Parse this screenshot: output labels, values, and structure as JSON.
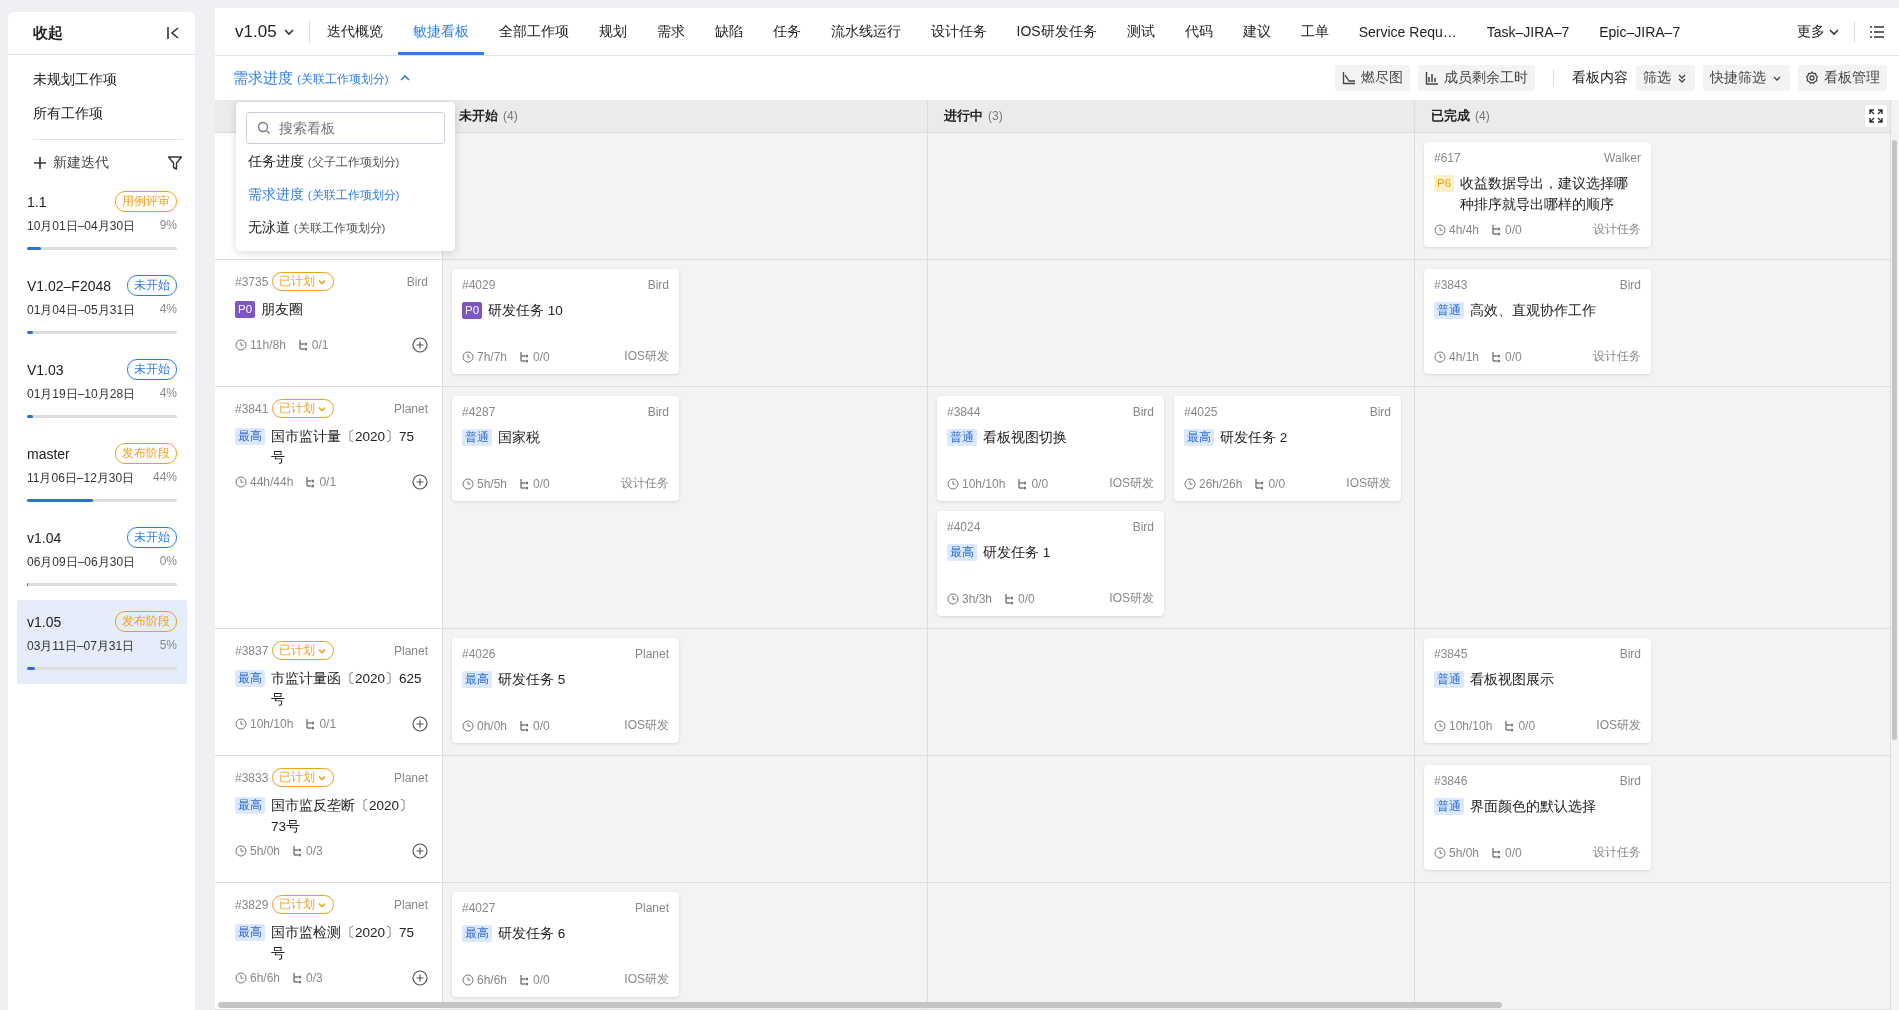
{
  "sidebar": {
    "header": "收起",
    "links": [
      "未规划工作项",
      "所有工作项"
    ],
    "new_label": "新建迭代",
    "iterations": [
      {
        "name": "1.1",
        "badge": "用例评审",
        "color": "#f0a020",
        "dates": "10月01日–04月30日",
        "percent": "9%",
        "level": 0.09,
        "selected": false
      },
      {
        "name": "V1.02–F2048",
        "badge": "未开始",
        "color": "#2f7ee8",
        "dates": "01月04日–05月31日",
        "percent": "4%",
        "level": 0.04,
        "selected": false
      },
      {
        "name": "V1.03",
        "badge": "未开始",
        "color": "#2f7ee8",
        "dates": "01月19日–10月28日",
        "percent": "4%",
        "level": 0.04,
        "selected": false
      },
      {
        "name": "master",
        "badge": "发布阶段",
        "color": "#f0a020",
        "dates": "11月06日–12月30日",
        "percent": "44%",
        "level": 0.44,
        "selected": false
      },
      {
        "name": "v1.04",
        "badge": "未开始",
        "color": "#2f7ee8",
        "dates": "06月09日–06月30日",
        "percent": "0%",
        "level": 0,
        "selected": false
      },
      {
        "name": "v1.05",
        "badge": "发布阶段",
        "color": "#f0a020",
        "dates": "03月11日–07月31日",
        "percent": "5%",
        "level": 0.05,
        "selected": true
      }
    ]
  },
  "version": "v1.05",
  "tabs": [
    {
      "label": "迭代概览",
      "selected": false
    },
    {
      "label": "敏捷看板",
      "selected": true
    },
    {
      "label": "全部工作项",
      "selected": false
    },
    {
      "label": "规划",
      "selected": false
    },
    {
      "label": "需求",
      "selected": false
    },
    {
      "label": "缺陷",
      "selected": false
    },
    {
      "label": "任务",
      "selected": false
    },
    {
      "label": "流水线运行",
      "selected": false
    },
    {
      "label": "设计任务",
      "selected": false
    },
    {
      "label": "IOS研发任务",
      "selected": false
    },
    {
      "label": "测试",
      "selected": false
    },
    {
      "label": "代码",
      "selected": false
    },
    {
      "label": "建议",
      "selected": false
    },
    {
      "label": "工单",
      "selected": false
    },
    {
      "label": "Service Requ…",
      "selected": false
    },
    {
      "label": "Task–JIRA–7",
      "selected": false
    },
    {
      "label": "Epic–JIRA–7",
      "selected": false
    }
  ],
  "more": "更多",
  "board_title": {
    "title": "需求进度",
    "note": "(关联工作项划分)"
  },
  "toolbar": {
    "burndown": "燃尽图",
    "member_hours": "成员剩余工时",
    "content_label": "看板内容",
    "filter": "筛选",
    "quick_filter": "快捷筛选",
    "manage": "看板管理"
  },
  "dropdown": {
    "placeholder": "搜索看板",
    "items": [
      {
        "text": "任务进度",
        "note": "(父子工作项划分)",
        "selected": false
      },
      {
        "text": "需求进度",
        "note": "(关联工作项划分)",
        "selected": true
      },
      {
        "text": "无泳道",
        "note": "(关联工作项划分)",
        "selected": false
      }
    ]
  },
  "columns": [
    {
      "title": "未开始",
      "count": "(4)"
    },
    {
      "title": "进行中",
      "count": "(3)"
    },
    {
      "title": "已完成",
      "count": "(4)"
    }
  ],
  "lanes": [
    {
      "cells": [
        [],
        [],
        [
          {
            "id": "#617",
            "owner": "Walker",
            "priority": {
              "text": "P6",
              "kind": "warn"
            },
            "title": "收益数据导出，建议选择哪种排序就导出哪样的顺序",
            "time": "4h/4h",
            "subtasks": "0/0",
            "type": "设计任务"
          }
        ]
      ]
    },
    {
      "lane": {
        "id": "#3735",
        "status": "已计划",
        "owner": "Bird",
        "priority": {
          "text": "P0",
          "kind": "p0"
        },
        "title": "朋友圈",
        "time": "11h/8h",
        "subtasks": "0/1"
      },
      "cells": [
        [
          {
            "id": "#4029",
            "owner": "Bird",
            "priority": {
              "text": "P0",
              "kind": "p0"
            },
            "title": "研发任务 10",
            "time": "7h/7h",
            "subtasks": "0/0",
            "type": "IOS研发"
          }
        ],
        [],
        [
          {
            "id": "#3843",
            "owner": "Bird",
            "priority": {
              "text": "普通",
              "kind": "info"
            },
            "title": "高效、直观协作工作",
            "time": "4h/1h",
            "subtasks": "0/0",
            "type": "设计任务"
          }
        ]
      ]
    },
    {
      "lane": {
        "id": "#3841",
        "status": "已计划",
        "owner": "Planet",
        "priority": {
          "text": "最高",
          "kind": "info"
        },
        "title": "国市监计量〔2020〕75号",
        "time": "44h/44h",
        "subtasks": "0/1"
      },
      "cells": [
        [
          {
            "id": "#4287",
            "owner": "Bird",
            "priority": {
              "text": "普通",
              "kind": "info"
            },
            "title": "国家税",
            "time": "5h/5h",
            "subtasks": "0/0",
            "type": "设计任务"
          }
        ],
        [
          {
            "id": "#3844",
            "owner": "Bird",
            "priority": {
              "text": "普通",
              "kind": "info"
            },
            "title": "看板视图切换",
            "time": "10h/10h",
            "subtasks": "0/0",
            "type": "IOS研发"
          },
          {
            "id": "#4025",
            "owner": "Bird",
            "priority": {
              "text": "最高",
              "kind": "info"
            },
            "title": "研发任务 2",
            "time": "26h/26h",
            "subtasks": "0/0",
            "type": "IOS研发"
          },
          {
            "id": "#4024",
            "owner": "Bird",
            "priority": {
              "text": "最高",
              "kind": "info"
            },
            "title": "研发任务 1",
            "time": "3h/3h",
            "subtasks": "0/0",
            "type": "IOS研发"
          }
        ],
        []
      ]
    },
    {
      "lane": {
        "id": "#3837",
        "status": "已计划",
        "owner": "Planet",
        "priority": {
          "text": "最高",
          "kind": "info"
        },
        "title": "市监计量函〔2020〕625号",
        "time": "10h/10h",
        "subtasks": "0/1"
      },
      "cells": [
        [
          {
            "id": "#4026",
            "owner": "Planet",
            "priority": {
              "text": "最高",
              "kind": "info"
            },
            "title": "研发任务 5",
            "time": "0h/0h",
            "subtasks": "0/0",
            "type": "IOS研发"
          }
        ],
        [],
        [
          {
            "id": "#3845",
            "owner": "Bird",
            "priority": {
              "text": "普通",
              "kind": "info"
            },
            "title": "看板视图展示",
            "time": "10h/10h",
            "subtasks": "0/0",
            "type": "IOS研发"
          }
        ]
      ]
    },
    {
      "lane": {
        "id": "#3833",
        "status": "已计划",
        "owner": "Planet",
        "priority": {
          "text": "最高",
          "kind": "info"
        },
        "title": "国市监反垄断〔2020〕73号",
        "time": "5h/0h",
        "subtasks": "0/3"
      },
      "cells": [
        [],
        [],
        [
          {
            "id": "#3846",
            "owner": "Bird",
            "priority": {
              "text": "普通",
              "kind": "info"
            },
            "title": "界面颜色的默认选择",
            "time": "5h/0h",
            "subtasks": "0/0",
            "type": "设计任务"
          }
        ]
      ]
    },
    {
      "lane": {
        "id": "#3829",
        "status": "已计划",
        "owner": "Planet",
        "priority": {
          "text": "最高",
          "kind": "info"
        },
        "title": "国市监检测〔2020〕75号",
        "time": "6h/6h",
        "subtasks": "0/3"
      },
      "cells": [
        [
          {
            "id": "#4027",
            "owner": "Planet",
            "priority": {
              "text": "最高",
              "kind": "info"
            },
            "title": "研发任务 6",
            "time": "6h/6h",
            "subtasks": "0/0",
            "type": "IOS研发"
          }
        ],
        [],
        []
      ]
    }
  ]
}
